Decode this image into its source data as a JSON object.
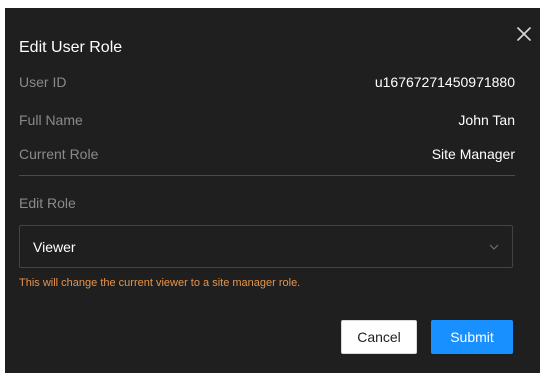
{
  "dialog": {
    "title": "Edit User Role",
    "close_icon": "close-icon"
  },
  "info": {
    "user_id_label": "User ID",
    "user_id_value": "u16767271450971880",
    "full_name_label": "Full Name",
    "full_name_value": "John Tan",
    "current_role_label": "Current Role",
    "current_role_value": "Site Manager"
  },
  "edit": {
    "label": "Edit Role",
    "selected_value": "Viewer",
    "arrow_icon": "chevron-down-icon",
    "warning": "This will change the current viewer to a site manager role."
  },
  "actions": {
    "cancel_label": "Cancel",
    "submit_label": "Submit"
  },
  "colors": {
    "dialog_bg": "#1f1f1f",
    "label_gray": "#8a8a8a",
    "warning_orange": "#e8944a",
    "primary_blue": "#1890ff"
  }
}
